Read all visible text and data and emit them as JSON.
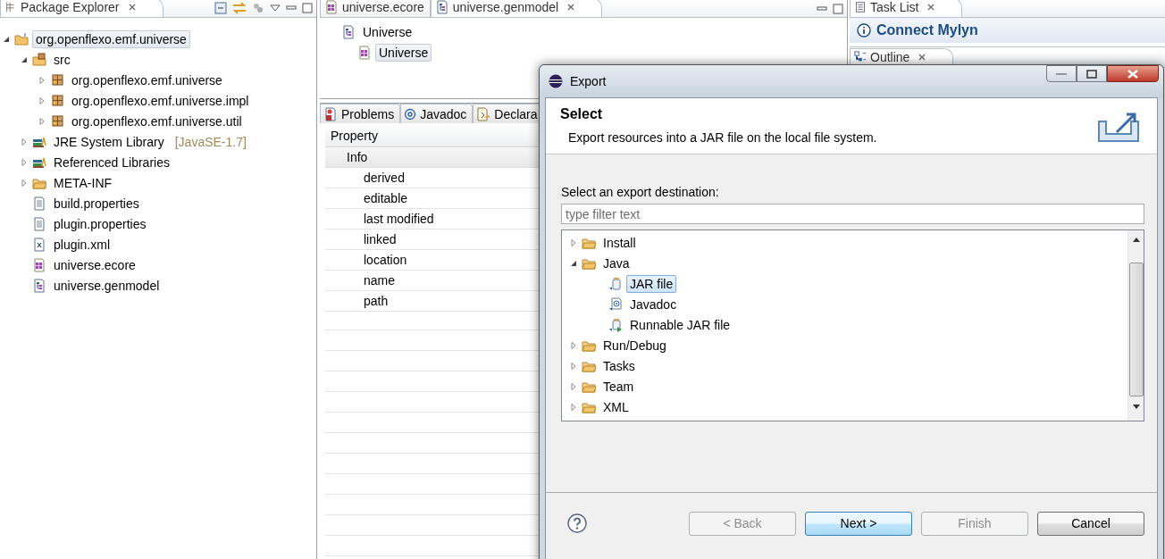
{
  "package_explorer": {
    "title": "Package Explorer",
    "tree": [
      {
        "label": "org.openflexo.emf.universe",
        "kind": "project",
        "expanded": true,
        "selected": true,
        "children": [
          {
            "label": "src",
            "kind": "source-folder",
            "expanded": true,
            "selected": false,
            "children": [
              {
                "label": "org.openflexo.emf.universe",
                "kind": "package",
                "expanded": false,
                "selected": false
              },
              {
                "label": "org.openflexo.emf.universe.impl",
                "kind": "package",
                "expanded": false,
                "selected": false
              },
              {
                "label": "org.openflexo.emf.universe.util",
                "kind": "package",
                "expanded": false,
                "selected": false
              }
            ]
          },
          {
            "label": "JRE System Library",
            "qualifier": "[JavaSE-1.7]",
            "kind": "library",
            "expanded": false,
            "selected": false
          },
          {
            "label": "Referenced Libraries",
            "kind": "library",
            "expanded": false,
            "selected": false
          },
          {
            "label": "META-INF",
            "kind": "folder",
            "expanded": false,
            "selected": false
          },
          {
            "label": "build.properties",
            "kind": "file",
            "selected": false
          },
          {
            "label": "plugin.properties",
            "kind": "file",
            "selected": false
          },
          {
            "label": "plugin.xml",
            "kind": "xml",
            "selected": false
          },
          {
            "label": "universe.ecore",
            "kind": "ecore",
            "selected": false
          },
          {
            "label": "universe.genmodel",
            "kind": "genmodel",
            "selected": false
          }
        ]
      }
    ]
  },
  "editor": {
    "tabs": [
      {
        "label": "universe.ecore",
        "kind": "ecore",
        "selected": false
      },
      {
        "label": "universe.genmodel",
        "kind": "genmodel",
        "selected": true
      }
    ],
    "tree": [
      {
        "label": "Universe",
        "kind": "genmodel",
        "selected": false,
        "children": [
          {
            "label": "Universe",
            "kind": "ecore",
            "selected": true
          }
        ]
      }
    ]
  },
  "bottom_panel": {
    "tabs": [
      {
        "label": "Problems",
        "kind": "problems",
        "selected": false
      },
      {
        "label": "Javadoc",
        "kind": "javadoc",
        "selected": false
      },
      {
        "label": "Declara",
        "kind": "declaration",
        "selected": false
      }
    ],
    "column": "Property",
    "rows": [
      {
        "label": "Info",
        "children": [
          {
            "label": "derived"
          },
          {
            "label": "editable"
          },
          {
            "label": "last modified"
          },
          {
            "label": "linked"
          },
          {
            "label": "location"
          },
          {
            "label": "name"
          },
          {
            "label": "path"
          }
        ]
      }
    ]
  },
  "task_list": {
    "title": "Task List",
    "link": "Connect Mylyn"
  },
  "outline": {
    "title": "Outline"
  },
  "dialog": {
    "title": "Export",
    "heading": "Select",
    "description": "Export resources into a JAR file on the local file system.",
    "label": "Select an export destination:",
    "filter": {
      "placeholder": "type filter text"
    },
    "tree": [
      {
        "label": "Install",
        "kind": "folder",
        "expanded": false,
        "selected": false
      },
      {
        "label": "Java",
        "kind": "folder",
        "expanded": true,
        "selected": false,
        "children": [
          {
            "label": "JAR file",
            "kind": "jar",
            "selected": true
          },
          {
            "label": "Javadoc",
            "kind": "javadoc",
            "selected": false
          },
          {
            "label": "Runnable JAR file",
            "kind": "runnable-jar",
            "selected": false
          }
        ]
      },
      {
        "label": "Run/Debug",
        "kind": "folder",
        "expanded": false,
        "selected": false
      },
      {
        "label": "Tasks",
        "kind": "folder",
        "expanded": false,
        "selected": false
      },
      {
        "label": "Team",
        "kind": "folder",
        "expanded": false,
        "selected": false
      },
      {
        "label": "XML",
        "kind": "folder",
        "expanded": false,
        "selected": false
      }
    ],
    "buttons": [
      {
        "label": "< Back",
        "disabled": true,
        "default": false
      },
      {
        "label": "Next >",
        "disabled": false,
        "default": true
      },
      {
        "label": "Finish",
        "disabled": true,
        "default": false
      },
      {
        "label": "Cancel",
        "disabled": false,
        "default": false
      }
    ]
  }
}
